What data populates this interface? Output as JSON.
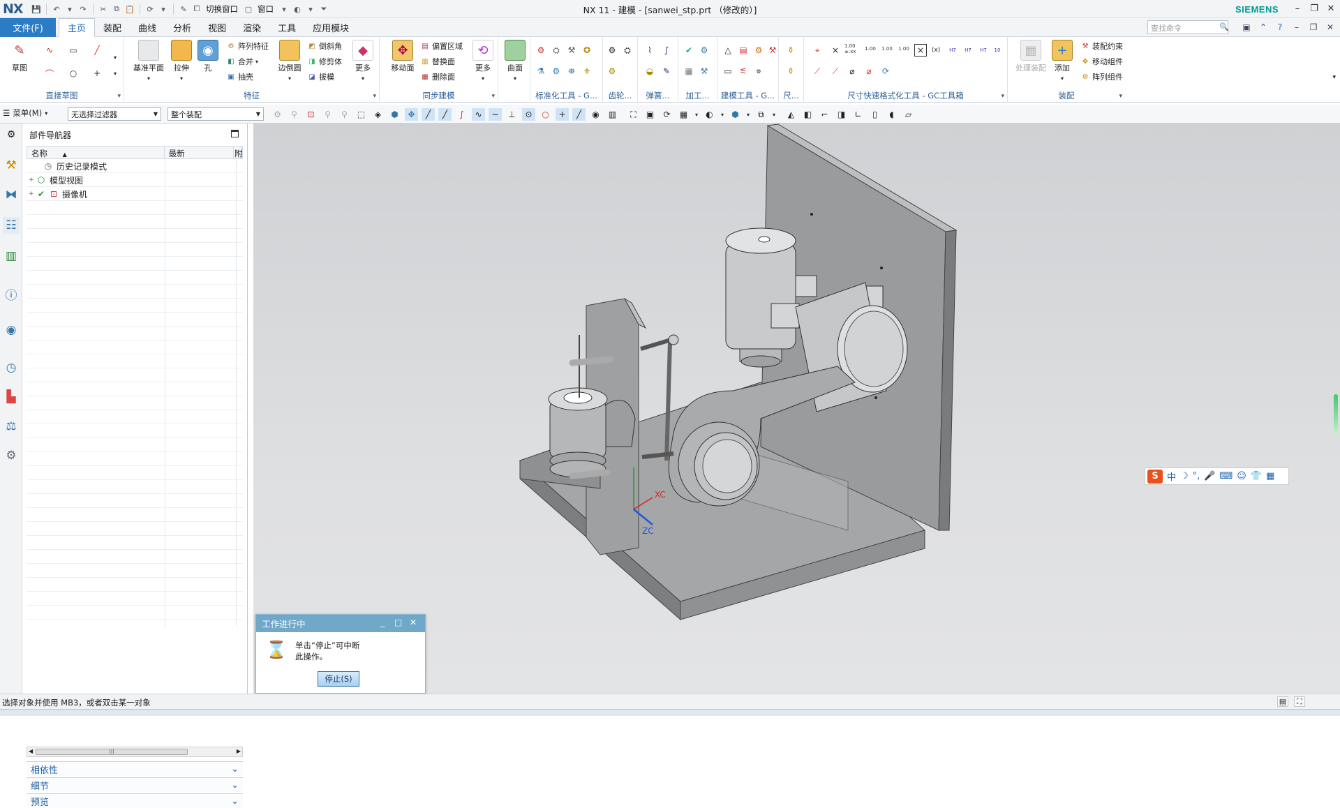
{
  "app": {
    "logo": "NX",
    "title": "NX 11 - 建模 - [sanwei_stp.prt （修改的）]",
    "brand": "SIEMENS"
  },
  "quick_access": {
    "switch_window": "切换窗口",
    "window": "窗口"
  },
  "menu": {
    "file": "文件(F)",
    "tabs": [
      "主页",
      "装配",
      "曲线",
      "分析",
      "视图",
      "渲染",
      "工具",
      "应用模块"
    ],
    "active_tab": "主页",
    "search_placeholder": "查找命令"
  },
  "ribbon": {
    "direct_sketch": {
      "label": "直接草图",
      "sketch": "草图"
    },
    "feature": {
      "label": "特征",
      "datum_plane": "基准平面",
      "extrude": "拉伸",
      "hole": "孔",
      "pattern_feature": "阵列特征",
      "unite": "合并",
      "shell": "抽壳",
      "edge_blend": "边倒圆",
      "chamfer": "倒斜角",
      "trim_body": "修剪体",
      "draft": "拔模",
      "more": "更多"
    },
    "sync": {
      "label": "同步建模",
      "move_face": "移动面",
      "offset_region": "偏置区域",
      "replace_face": "替换面",
      "delete_face": "删除面",
      "more": "更多"
    },
    "surface": {
      "label": "曲面"
    },
    "std_tools": {
      "label": "标准化工具 - G..."
    },
    "gear": {
      "label": "齿轮..."
    },
    "spring": {
      "label": "弹簧..."
    },
    "machining": {
      "label": "加工..."
    },
    "build_tools": {
      "label": "建模工具 - G..."
    },
    "misc": {
      "label": "尺..."
    },
    "dim_tools": {
      "label": "尺寸快速格式化工具 - GC工具箱",
      "tols": [
        "1.00 ±.xx",
        "1.00",
        "1.00",
        "1.00"
      ],
      "h7": [
        "H7",
        "H7",
        "H7"
      ]
    },
    "assembly": {
      "label": "装配",
      "process": "处理装配",
      "add": "添加",
      "constraint": "装配约束",
      "move_component": "移动组件",
      "pattern_component": "阵列组件"
    }
  },
  "toolbar2": {
    "menu": "菜单(M)",
    "filter": "无选择过滤器",
    "scope": "整个装配"
  },
  "navigator": {
    "title": "部件导航器",
    "columns": [
      "名称",
      "最新",
      "附"
    ],
    "rows": [
      {
        "label": "历史记录模式"
      },
      {
        "label": "模型视图"
      },
      {
        "label": "摄像机"
      }
    ],
    "sections": [
      "相依性",
      "细节",
      "预览"
    ]
  },
  "viewport": {
    "axis_x": "XC",
    "axis_z": "ZC"
  },
  "dialog": {
    "title": "工作进行中",
    "message_line1": "单击“停止”可中断",
    "message_line2": "此操作。",
    "stop": "停止(S)"
  },
  "ime": {
    "logo": "S",
    "mode": "中"
  },
  "status": {
    "text": "选择对象并使用 MB3，或者双击某一对象"
  },
  "colors": {
    "accent": "#2b7bc5",
    "dialog_header": "#6fa8c9",
    "brand": "#009999"
  }
}
